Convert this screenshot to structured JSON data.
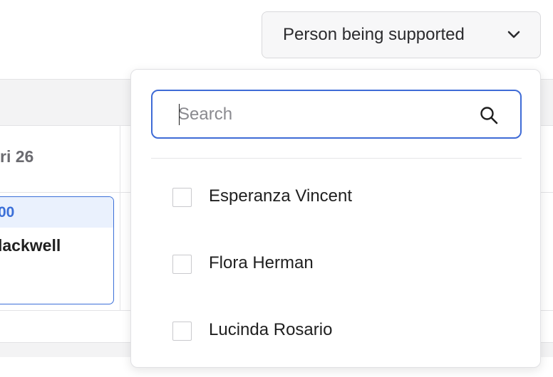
{
  "calendar": {
    "day_label": "ri 26",
    "event": {
      "time": "00",
      "title": "lackwell"
    }
  },
  "filter": {
    "trigger_label": "Person being supported",
    "trigger_icon": "chevron-down-icon",
    "search": {
      "placeholder": "Search",
      "value": "",
      "icon": "search-icon"
    },
    "options": [
      {
        "label": "Esperanza Vincent",
        "checked": false
      },
      {
        "label": "Flora Herman",
        "checked": false
      },
      {
        "label": "Lucinda Rosario",
        "checked": false
      }
    ]
  },
  "colors": {
    "accent": "#3f6bd6",
    "event_time": "#3b6fd8",
    "event_time_bg": "#eaf1fd",
    "muted_text": "#6b6b70",
    "header_bg": "#f3f3f4"
  }
}
